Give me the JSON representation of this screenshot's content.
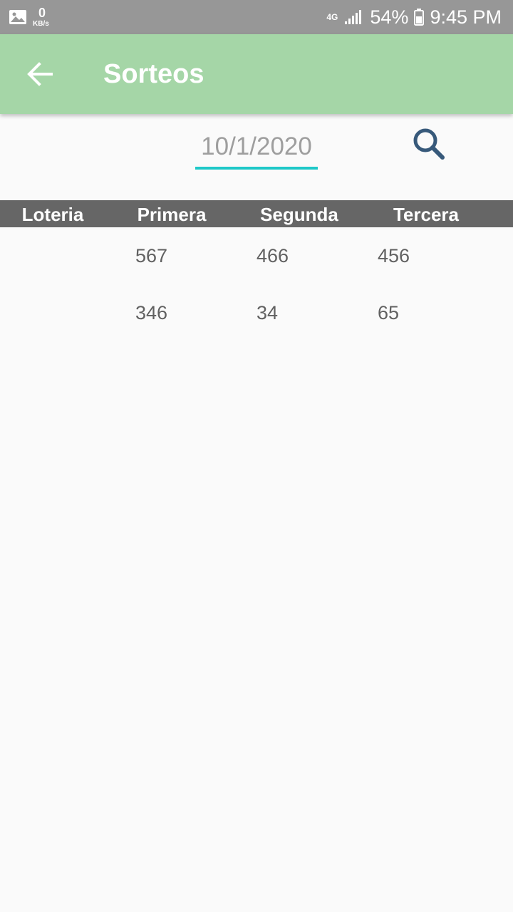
{
  "status_bar": {
    "net_speed_value": "0",
    "net_speed_unit": "KB/s",
    "network_type": "4G",
    "battery_percent": "54%",
    "time": "9:45 PM"
  },
  "app_bar": {
    "title": "Sorteos",
    "back_icon": "arrow-back-icon"
  },
  "filter": {
    "date_value": "10/1/2020",
    "search_icon": "search-icon"
  },
  "table": {
    "columns": [
      "Loteria",
      "Primera",
      "Segunda",
      "Tercera"
    ],
    "rows": [
      {
        "loteria": "",
        "primera": "567",
        "segunda": "466",
        "tercera": "456"
      },
      {
        "loteria": "",
        "primera": "346",
        "segunda": "34",
        "tercera": "65"
      }
    ]
  },
  "colors": {
    "status_bar": "#979797",
    "app_bar": "#a5d6a7",
    "date_underline": "#1ec8c8",
    "search_icon": "#37597a",
    "table_header": "#666666"
  }
}
